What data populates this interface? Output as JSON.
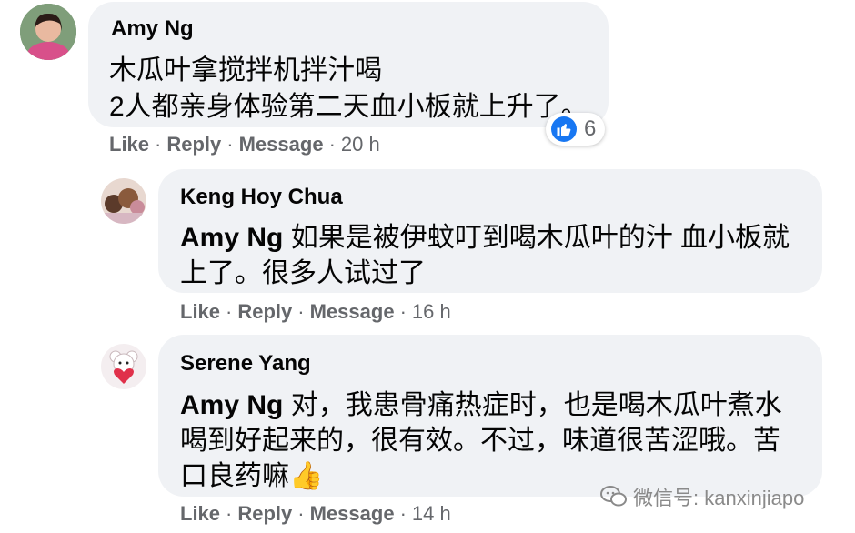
{
  "comments": [
    {
      "author": "Amy Ng",
      "avatar_icon": "woman-portrait-avatar",
      "lines": [
        {
          "mention": "",
          "text": "木瓜叶拿搅拌机拌汁喝"
        },
        {
          "mention": "",
          "text": "2人都亲身体验第二天血小板就上升了。"
        }
      ],
      "actions": {
        "like": "Like",
        "reply": "Reply",
        "message": "Message",
        "time": "20 h"
      },
      "reactions": {
        "icon": "thumbs-up-icon",
        "count": "6"
      }
    },
    {
      "author": "Keng Hoy Chua",
      "avatar_icon": "stuffed-toys-avatar",
      "lines": [
        {
          "mention": "Amy Ng",
          "text": " 如果是被伊蚊叮到喝木瓜叶的汁 血小板就"
        },
        {
          "mention": "",
          "text": "上了。很多人试过了"
        }
      ],
      "actions": {
        "like": "Like",
        "reply": "Reply",
        "message": "Message",
        "time": "16 h"
      }
    },
    {
      "author": "Serene Yang",
      "avatar_icon": "teddy-bear-heart-avatar",
      "lines": [
        {
          "mention": "Amy Ng",
          "text": " 对，我患骨痛热症时，也是喝木瓜叶煮水"
        },
        {
          "mention": "",
          "text": "喝到好起来的，很有效。不过，味道很苦涩哦。苦"
        },
        {
          "mention": "",
          "text": "口良药嘛",
          "emoji": "👍"
        }
      ],
      "actions": {
        "like": "Like",
        "reply": "Reply",
        "message": "Message",
        "time": "14 h"
      }
    }
  ],
  "separator": "·",
  "watermark": {
    "icon": "wechat-icon",
    "text": "微信号: kanxinjiapo"
  },
  "colors": {
    "bubble": "#f0f2f5",
    "meta": "#65676b",
    "like_blue": "#1877f2"
  }
}
